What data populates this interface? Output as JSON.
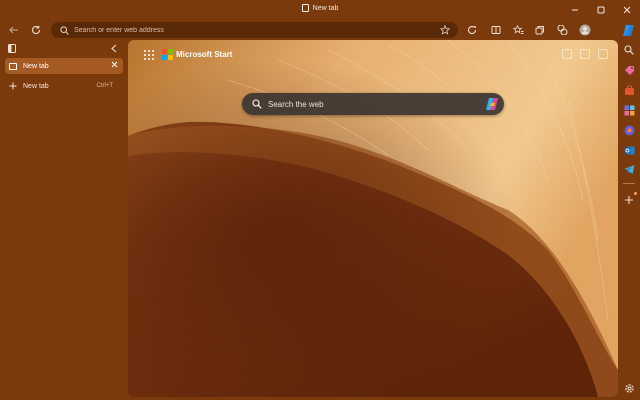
{
  "window": {
    "title": "New tab",
    "minimize_icon": "minimize-icon",
    "maximize_icon": "maximize-icon",
    "close_icon": "close-icon"
  },
  "toolbar": {
    "address_placeholder": "Search or enter web address",
    "icons": [
      "back-arrow-icon",
      "refresh-icon",
      "favorite-star-icon",
      "tracking-prevention-icon",
      "split-screen-icon",
      "favorites-icon",
      "collections-icon",
      "extensions-icon",
      "profile-avatar-icon",
      "copilot-icon"
    ]
  },
  "sidebar": {
    "active_tab": {
      "label": "New tab"
    },
    "new_tab": {
      "label": "New tab",
      "shortcut": "Ctrl+T"
    }
  },
  "newtab_page": {
    "brand": "Microsoft Start",
    "search_placeholder": "Search the web",
    "logo_colors": [
      "#f35325",
      "#81bc06",
      "#05a6f0",
      "#ffba08"
    ]
  },
  "rightbar": {
    "icons": [
      "search-icon",
      "shopping-tag-icon",
      "tools-icon",
      "games-icon",
      "outlook-icon",
      "telegram-icon",
      "add-icon",
      "settings-icon"
    ]
  },
  "colors": {
    "frame": "#7a3a0c",
    "address_bar": "#5a2908",
    "active_tab": "#a55a23"
  }
}
